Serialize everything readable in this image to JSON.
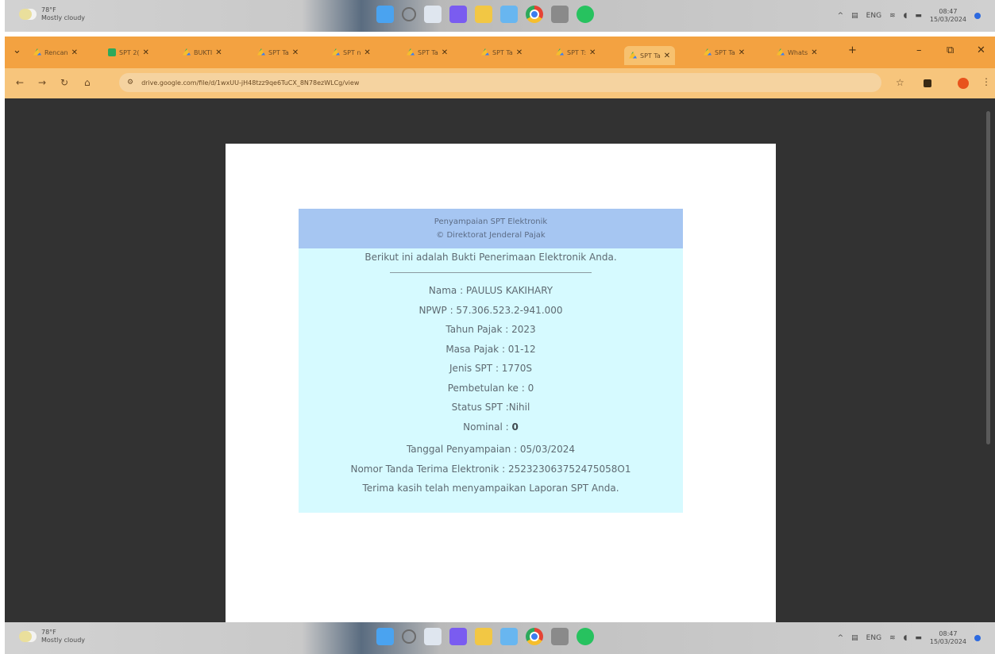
{
  "taskbar": {
    "weather_temp": "78°F",
    "weather_desc": "Mostly cloudy",
    "lang": "ENG",
    "time": "08:47",
    "date": "15/03/2024"
  },
  "tabs": [
    {
      "label": "Rencan",
      "active": false
    },
    {
      "label": "SPT 2(",
      "active": false
    },
    {
      "label": "BUKTI",
      "active": false
    },
    {
      "label": "SPT Ta",
      "active": false
    },
    {
      "label": "SPT n",
      "active": false
    },
    {
      "label": "SPT Ta",
      "active": false
    },
    {
      "label": "SPT Ta",
      "active": false
    },
    {
      "label": "SPT T:",
      "active": false
    },
    {
      "label": "SPT Ta",
      "active": true
    },
    {
      "label": "SPT Ta",
      "active": false
    },
    {
      "label": "Whats",
      "active": false
    }
  ],
  "browser": {
    "url": "drive.google.com/file/d/1wxUU-jH48tzz9qe6TuCX_8N78ezWLCg/view",
    "new_tab": "+"
  },
  "receipt": {
    "header_line1": "Penyampaian SPT Elektronik",
    "header_line2": "© Direktorat Jenderal Pajak",
    "intro": "Berikut ini adalah Bukti Penerimaan Elektronik Anda.",
    "nama": "Nama : PAULUS KAKIHARY",
    "npwp": "NPWP : 57.306.523.2-941.000",
    "tahun_pajak": "Tahun Pajak : 2023",
    "masa_pajak": "Masa Pajak : 01-12",
    "jenis_spt": "Jenis SPT : 1770S",
    "pembetulan": "Pembetulan ke : 0",
    "status_spt": "Status SPT :Nihil",
    "nominal_label": "Nominal : ",
    "nominal_value": "0",
    "tanggal": "Tanggal Penyampaian : 05/03/2024",
    "nomor": "Nomor Tanda Terima Elektronik : 252323063752475058O1",
    "thanks": "Terima kasih telah menyampaikan Laporan SPT Anda."
  }
}
